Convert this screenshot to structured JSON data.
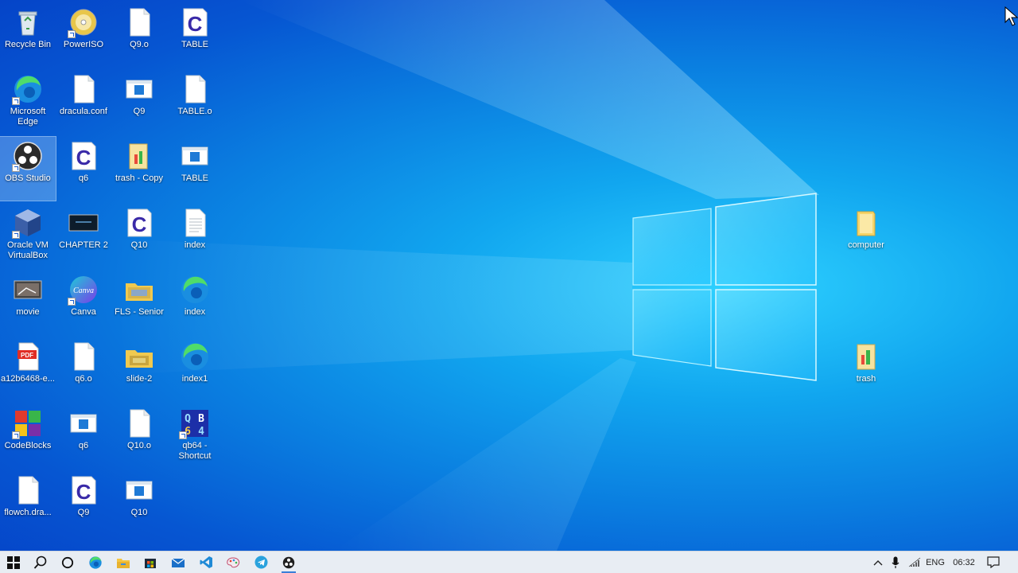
{
  "desktop": {
    "icons": [
      {
        "label": "Recycle Bin",
        "icon": "recycle-bin-icon"
      },
      {
        "label": "PowerISO",
        "icon": "poweriso-icon"
      },
      {
        "label": "Q9.o",
        "icon": "file-icon"
      },
      {
        "label": "TABLE",
        "icon": "c-file-icon"
      },
      {
        "label": "Microsoft Edge",
        "icon": "edge-icon"
      },
      {
        "label": "dracula.conf",
        "icon": "file-icon"
      },
      {
        "label": "Q9",
        "icon": "app-window-icon"
      },
      {
        "label": "TABLE.o",
        "icon": "file-icon"
      },
      {
        "label": "OBS Studio",
        "icon": "obs-icon"
      },
      {
        "label": "q6",
        "icon": "c-file-icon"
      },
      {
        "label": "trash - Copy",
        "icon": "folder-icon"
      },
      {
        "label": "TABLE",
        "icon": "app-window-icon"
      },
      {
        "label": "Oracle VM VirtualBox",
        "icon": "virtualbox-icon"
      },
      {
        "label": "CHAPTER 2",
        "icon": "video-thumbnail-icon"
      },
      {
        "label": "Q10",
        "icon": "c-file-icon"
      },
      {
        "label": "index",
        "icon": "text-file-icon"
      },
      {
        "label": "movie",
        "icon": "movie-icon"
      },
      {
        "label": "Canva",
        "icon": "canva-icon"
      },
      {
        "label": "FLS - Senior",
        "icon": "folder-icon"
      },
      {
        "label": "index",
        "icon": "edge-icon"
      },
      {
        "label": "a12b6468-e...",
        "icon": "pdf-icon"
      },
      {
        "label": "q6.o",
        "icon": "file-icon"
      },
      {
        "label": "slide-2",
        "icon": "folder-icon"
      },
      {
        "label": "index1",
        "icon": "edge-icon"
      },
      {
        "label": "CodeBlocks",
        "icon": "codeblocks-icon"
      },
      {
        "label": "q6",
        "icon": "app-window-icon"
      },
      {
        "label": "Q10.o",
        "icon": "file-icon"
      },
      {
        "label": "qb64 - Shortcut",
        "icon": "qb64-icon"
      },
      {
        "label": "flowch.dra...",
        "icon": "file-icon"
      },
      {
        "label": "Q9",
        "icon": "c-file-icon"
      },
      {
        "label": "Q10",
        "icon": "app-window-icon"
      },
      {
        "label": "computer",
        "icon": "folder-icon"
      },
      {
        "label": "trash",
        "icon": "folder-icon"
      }
    ]
  },
  "taskbar": {
    "items": [
      {
        "name": "start-button",
        "icon": "windows-start-icon"
      },
      {
        "name": "search-button",
        "icon": "search-icon"
      },
      {
        "name": "cortana-button",
        "icon": "cortana-circle-icon"
      },
      {
        "name": "taskbar-edge",
        "icon": "edge-icon"
      },
      {
        "name": "taskbar-file-explorer",
        "icon": "file-explorer-icon"
      },
      {
        "name": "taskbar-store",
        "icon": "store-icon"
      },
      {
        "name": "taskbar-mail",
        "icon": "mail-icon"
      },
      {
        "name": "taskbar-vscode",
        "icon": "vscode-icon"
      },
      {
        "name": "taskbar-paint",
        "icon": "paint-icon"
      },
      {
        "name": "taskbar-telegram",
        "icon": "telegram-icon"
      },
      {
        "name": "taskbar-obs",
        "icon": "obs-icon"
      }
    ],
    "tray": {
      "language": "ENG",
      "time": "06:32"
    }
  }
}
